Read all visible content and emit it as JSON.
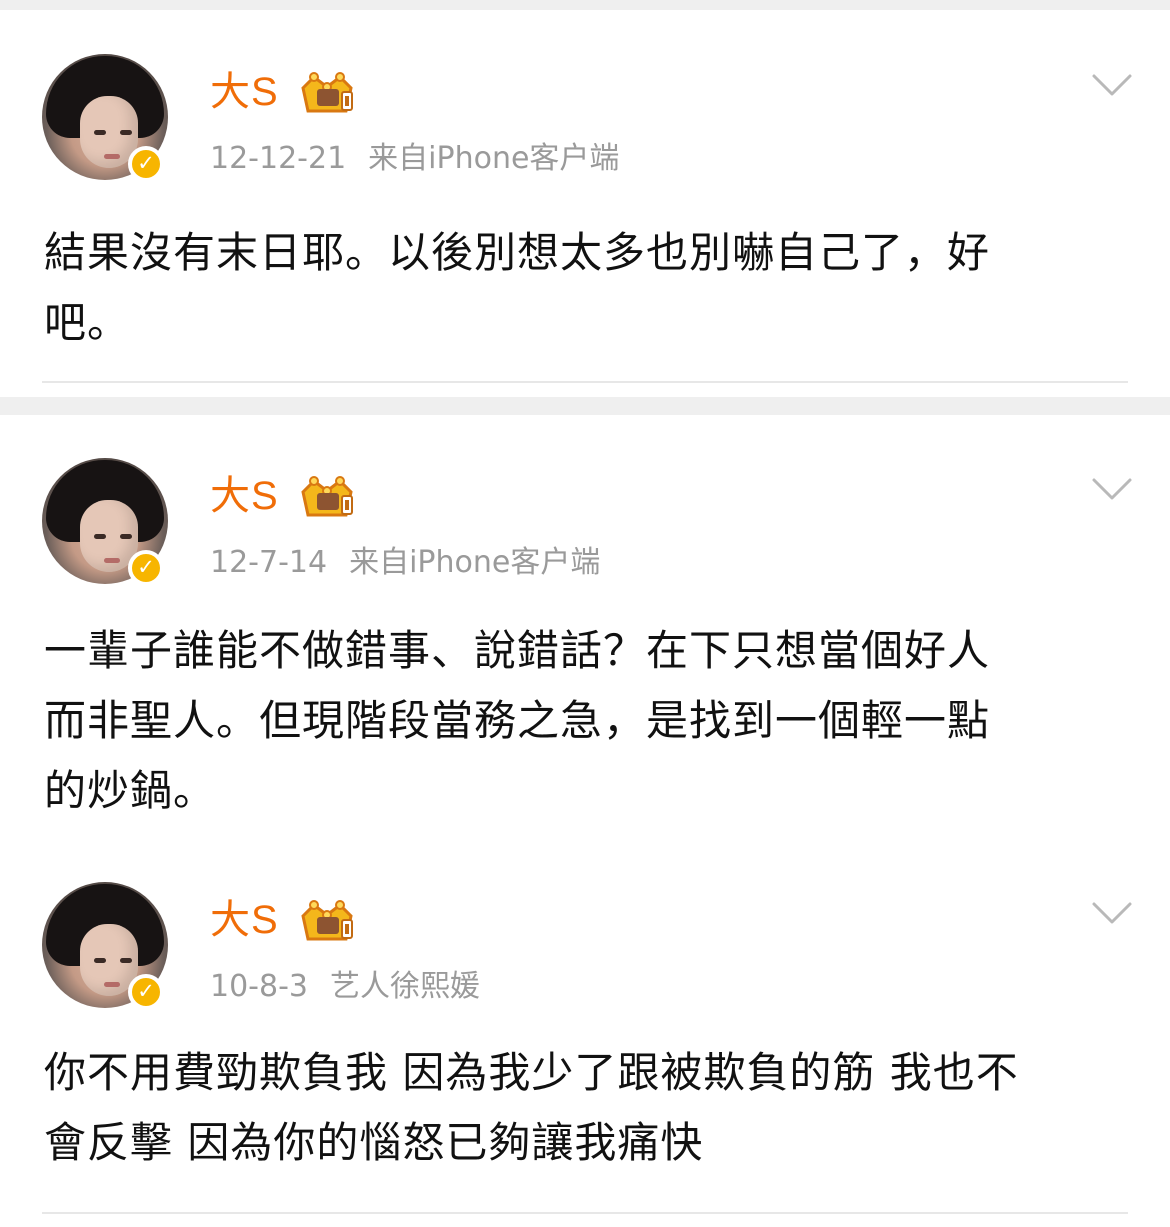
{
  "posts": [
    {
      "author": "大S",
      "date": "12-12-21",
      "source": "来自iPhone客户端",
      "text_lines": [
        "結果沒有末日耶。以後別想太多也別嚇自己了，好",
        "吧。"
      ],
      "verified_icon": "verified-badge-icon",
      "crown_icon": "vip-crown-icon",
      "menu_icon": "chevron-down-icon"
    },
    {
      "author": "大S",
      "date": "12-7-14",
      "source": "来自iPhone客户端",
      "text_lines": [
        "一輩子誰能不做錯事、說錯話？在下只想當個好人",
        "而非聖人。但現階段當務之急，是找到一個輕一點",
        "的炒鍋。"
      ],
      "verified_icon": "verified-badge-icon",
      "crown_icon": "vip-crown-icon",
      "menu_icon": "chevron-down-icon"
    },
    {
      "author": "大S",
      "date": "10-8-3",
      "source": "艺人徐熙媛",
      "text_lines": [
        "你不用費勁欺負我 因為我少了跟被欺負的筋 我也不",
        "會反擊 因為你的惱怒已夠讓我痛快"
      ],
      "verified_icon": "verified-badge-icon",
      "crown_icon": "vip-crown-icon",
      "menu_icon": "chevron-down-icon"
    }
  ],
  "colors": {
    "author": "#f06d08",
    "meta": "#9a9a9a",
    "verified": "#f7b500",
    "separator": "#efefef"
  }
}
